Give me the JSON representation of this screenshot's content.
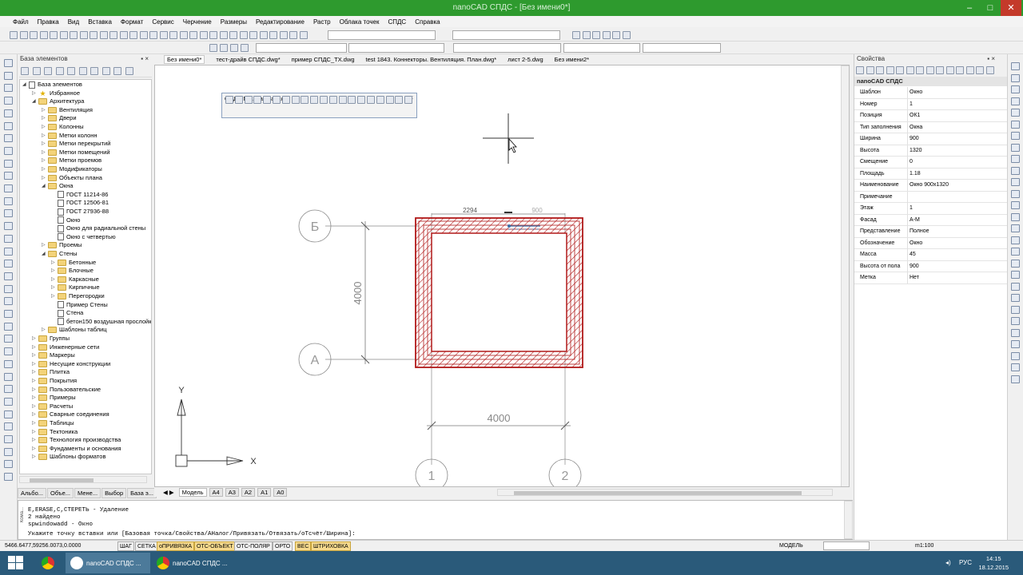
{
  "window": {
    "title": "nanoCAD СПДС - [Без имени0*]",
    "controls": [
      "–",
      "□",
      "✕"
    ]
  },
  "menu": [
    "Файл",
    "Правка",
    "Вид",
    "Вставка",
    "Формат",
    "Сервис",
    "Черчение",
    "Размеры",
    "Редактирование",
    "Растр",
    "Облака точек",
    "СПДС",
    "Справка"
  ],
  "left_panel": {
    "title": "База элементов",
    "tree": [
      {
        "label": "База элементов",
        "level": 0,
        "kind": "doc",
        "expanded": true
      },
      {
        "label": "Избранное",
        "level": 1,
        "kind": "star",
        "expanded": false
      },
      {
        "label": "Архитектура",
        "level": 1,
        "kind": "folder",
        "expanded": true
      },
      {
        "label": "Вентиляция",
        "level": 2,
        "kind": "folder",
        "expanded": false
      },
      {
        "label": "Двери",
        "level": 2,
        "kind": "folder",
        "expanded": false
      },
      {
        "label": "Колонны",
        "level": 2,
        "kind": "folder",
        "expanded": false
      },
      {
        "label": "Метки колонн",
        "level": 2,
        "kind": "folder",
        "expanded": false
      },
      {
        "label": "Метки перекрытий",
        "level": 2,
        "kind": "folder",
        "expanded": false
      },
      {
        "label": "Метки помещений",
        "level": 2,
        "kind": "folder",
        "expanded": false
      },
      {
        "label": "Метки проемов",
        "level": 2,
        "kind": "folder",
        "expanded": false
      },
      {
        "label": "Модификаторы",
        "level": 2,
        "kind": "folder",
        "expanded": false
      },
      {
        "label": "Объекты плана",
        "level": 2,
        "kind": "folder",
        "expanded": false
      },
      {
        "label": "Окна",
        "level": 2,
        "kind": "folder",
        "expanded": true
      },
      {
        "label": "ГОСТ 11214-86",
        "level": 3,
        "kind": "doc",
        "expanded": false
      },
      {
        "label": "ГОСТ 12506-81",
        "level": 3,
        "kind": "doc",
        "expanded": false
      },
      {
        "label": "ГОСТ 27936-88",
        "level": 3,
        "kind": "doc",
        "expanded": false
      },
      {
        "label": "Окно",
        "level": 3,
        "kind": "doc",
        "expanded": false
      },
      {
        "label": "Окно для радиальной стены",
        "level": 3,
        "kind": "doc",
        "expanded": false
      },
      {
        "label": "Окно с четвертью",
        "level": 3,
        "kind": "doc",
        "expanded": false
      },
      {
        "label": "Проемы",
        "level": 2,
        "kind": "folder",
        "expanded": false
      },
      {
        "label": "Стены",
        "level": 2,
        "kind": "folder",
        "expanded": true
      },
      {
        "label": "Бетонные",
        "level": 3,
        "kind": "folder",
        "expanded": false
      },
      {
        "label": "Блочные",
        "level": 3,
        "kind": "folder",
        "expanded": false
      },
      {
        "label": "Каркасные",
        "level": 3,
        "kind": "folder",
        "expanded": false
      },
      {
        "label": "Кирпичные",
        "level": 3,
        "kind": "folder",
        "expanded": false
      },
      {
        "label": "Перегородки",
        "level": 3,
        "kind": "folder",
        "expanded": false
      },
      {
        "label": "Пример Стены",
        "level": 3,
        "kind": "doc",
        "expanded": false
      },
      {
        "label": "Стена",
        "level": 3,
        "kind": "doc",
        "expanded": false
      },
      {
        "label": "бетон150 воздушная прослойк",
        "level": 3,
        "kind": "doc",
        "expanded": false
      },
      {
        "label": "Шаблоны таблиц",
        "level": 2,
        "kind": "folder",
        "expanded": false
      },
      {
        "label": "Группы",
        "level": 1,
        "kind": "folder",
        "expanded": false
      },
      {
        "label": "Инженерные сети",
        "level": 1,
        "kind": "folder",
        "expanded": false
      },
      {
        "label": "Маркеры",
        "level": 1,
        "kind": "folder",
        "expanded": false
      },
      {
        "label": "Несущие конструкции",
        "level": 1,
        "kind": "folder",
        "expanded": false
      },
      {
        "label": "Плитка",
        "level": 1,
        "kind": "folder",
        "expanded": false
      },
      {
        "label": "Покрытия",
        "level": 1,
        "kind": "folder",
        "expanded": false
      },
      {
        "label": "Пользовательские",
        "level": 1,
        "kind": "folder",
        "expanded": false
      },
      {
        "label": "Примеры",
        "level": 1,
        "kind": "folder",
        "expanded": false
      },
      {
        "label": "Расчеты",
        "level": 1,
        "kind": "folder",
        "expanded": false
      },
      {
        "label": "Сварные соединения",
        "level": 1,
        "kind": "folder",
        "expanded": false
      },
      {
        "label": "Таблицы",
        "level": 1,
        "kind": "folder",
        "expanded": false
      },
      {
        "label": "Тектоника",
        "level": 1,
        "kind": "folder",
        "expanded": false
      },
      {
        "label": "Технология производства",
        "level": 1,
        "kind": "folder",
        "expanded": false
      },
      {
        "label": "Фундаменты и основания",
        "level": 1,
        "kind": "folder",
        "expanded": false
      },
      {
        "label": "Шаблоны форматов",
        "level": 1,
        "kind": "folder",
        "expanded": false
      }
    ],
    "bottom_tabs": [
      "Альбо...",
      "Объе...",
      "Мене...",
      "Выбор",
      "База э..."
    ]
  },
  "doc_tabs": {
    "items": [
      "Без имени0*",
      "тест-драйв СПДС.dwg*",
      "пример СПДС_TX.dwg",
      "test 1843. Коннекторы. Вентиляция. План.dwg*",
      "лист 2-5.dwg",
      "Без имени2*"
    ],
    "active_index": 0
  },
  "float_panel": {
    "title": "СПДС Главная панель",
    "close": "×"
  },
  "drawing": {
    "axis_letters": [
      "Б",
      "А"
    ],
    "axis_numbers": [
      "1",
      "2"
    ],
    "dim_vertical": "4000",
    "dim_horizontal": "4000",
    "dim_top": "2294",
    "dim_top_right": "900",
    "ucs_x": "X",
    "ucs_y": "Y"
  },
  "layout_tabs": [
    "Модель",
    "А4",
    "А3",
    "А2",
    "А1",
    "А0"
  ],
  "properties": {
    "title": "Свойства",
    "group": "nanoCAD СПДС",
    "rows": [
      {
        "key": "Шаблон",
        "value": "Окно"
      },
      {
        "key": "Номер",
        "value": "1"
      },
      {
        "key": "Позиция",
        "value": "ОК1"
      },
      {
        "key": "Тип заполнения",
        "value": "Окна"
      },
      {
        "key": "Ширина",
        "value": "900"
      },
      {
        "key": "Высота",
        "value": "1320"
      },
      {
        "key": "Смещение",
        "value": "0"
      },
      {
        "key": "Площадь",
        "value": "1.18"
      },
      {
        "key": "Наименование",
        "value": "Окно 900x1320"
      },
      {
        "key": "Примечание",
        "value": ""
      },
      {
        "key": "Этаж",
        "value": "1"
      },
      {
        "key": "Фасад",
        "value": "А-М"
      },
      {
        "key": "Представление",
        "value": "Полное"
      },
      {
        "key": "Обозначение",
        "value": "Окно"
      },
      {
        "key": "Масса",
        "value": "45"
      },
      {
        "key": "Высота от пола",
        "value": "900"
      },
      {
        "key": "Метка",
        "value": "Нет"
      }
    ]
  },
  "command": {
    "side_label": "Кома...",
    "lines": [
      "E,ERASE,С,СТЕРЕТЬ - Удаление",
      "2 найдено",
      "spwindowadd - Окно",
      "Укажите точку вставки или [Базовая точка/Свойства/АНалог/Привязать/Отвязать/оТсчёт/Ширина]:"
    ]
  },
  "status": {
    "coords": "5466.6477,59256.0073,0.0000",
    "buttons": [
      {
        "label": "ШАГ",
        "on": false
      },
      {
        "label": "СЕТКА",
        "on": false
      },
      {
        "label": "оПРИВЯЗКА",
        "on": true
      },
      {
        "label": "ОТС-ОБЪЕКТ",
        "on": true
      },
      {
        "label": "ОТС-ПОЛЯР",
        "on": false
      },
      {
        "label": "ОРТО",
        "on": false
      },
      {
        "label": "ВЕС",
        "on": true
      },
      {
        "label": "ШТРИХОВКА",
        "on": true
      }
    ],
    "model": "МОДЕЛЬ",
    "scale": "m1:100"
  },
  "taskbar": {
    "apps": [
      "nanoCAD СПДС ...",
      "nanoCAD СПДС ..."
    ],
    "lang": "РУС",
    "time": "14:15",
    "date": "18.12.2015"
  },
  "colors": {
    "title_green": "#2e9a2e",
    "wall_red": "#b01818",
    "taskbar": "#2a5a7a",
    "status_on": "#f6d98c"
  }
}
